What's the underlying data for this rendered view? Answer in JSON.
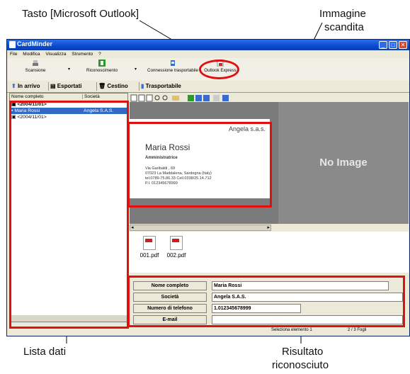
{
  "callouts": {
    "outlook_key": "Tasto [Microsoft Outlook]",
    "scanned_image_line1": "Immagine",
    "scanned_image_line2": "scandita",
    "data_list": "Lista dati",
    "result_line1": "Risultato",
    "result_line2": "riconosciuto"
  },
  "window": {
    "title": "CardMinder",
    "menu": [
      "File",
      "Modifica",
      "Visualizza",
      "Strumento",
      "?"
    ]
  },
  "toolbar": {
    "scan": "Scansione",
    "recognize": "Riconoscimento",
    "connect": "Connessione trasportabile",
    "outlook": "Outlook Express"
  },
  "nav": {
    "inbox": "In arrivo",
    "export": "Esportati",
    "trash": "Cestino",
    "portable": "Trasportabile"
  },
  "list": {
    "col_name": "Nome completo",
    "col_company": "Società",
    "rows": [
      {
        "name": "<2004/11/01>",
        "company": ""
      },
      {
        "name": "Maria Rossi",
        "company": "Angela S.A.S."
      },
      {
        "name": "<2004/11/01>",
        "company": ""
      }
    ]
  },
  "card": {
    "company": "Angela s.a.s.",
    "name": "Maria Rossi",
    "role": "Amministratrice",
    "addr1": "Via Garibaldi , 69",
    "addr2": "07023 La Maddalena, Sardegna (Italy)",
    "phone": "tel.0789-75.86.33   Cell.0338/25.14.712",
    "vat": "P.I. 012345678999"
  },
  "no_image": "No Image",
  "files": [
    "001.pdf",
    "002.pdf"
  ],
  "fields": [
    {
      "label": "Nome completo",
      "value": "Maria Rossi"
    },
    {
      "label": "Società",
      "value": "Angela S.A.S."
    },
    {
      "label": "Numero di telefono",
      "value": "1.012345678999"
    },
    {
      "label": "E-mail",
      "value": ""
    }
  ],
  "status": {
    "selected": "Seleziona elemento 1",
    "pages": "2 /    3 Fogli"
  },
  "colors": {
    "highlight": "#e01010",
    "selection": "#316ac5",
    "titlebar": "#0a4ad0"
  }
}
